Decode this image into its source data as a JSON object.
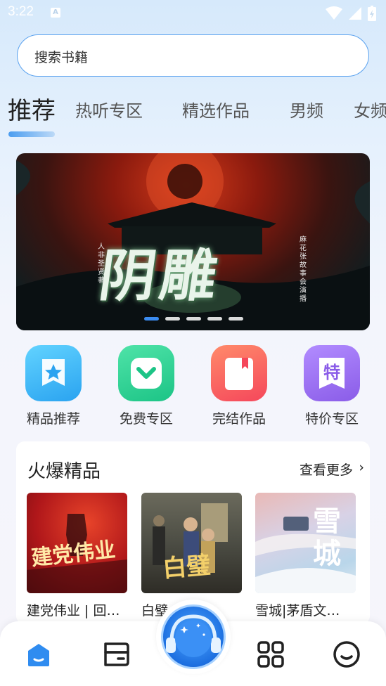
{
  "status_bar": {
    "time": "3:22",
    "notification_letter": "A"
  },
  "search": {
    "placeholder": "搜索书籍"
  },
  "tabs": [
    {
      "label": "推荐",
      "active": true
    },
    {
      "label": "热听专区"
    },
    {
      "label": "精选作品"
    },
    {
      "label": "男频"
    },
    {
      "label": "女频"
    }
  ],
  "banner": {
    "title": "阴雕",
    "side_left": "人非圣贤著",
    "side_right": "麻花张故事会演播",
    "dots": 5,
    "active_dot": 0
  },
  "categories": [
    {
      "label": "精品推荐",
      "icon": "star-badge-icon",
      "color": "#34b6f5"
    },
    {
      "label": "免费专区",
      "icon": "chevron-down-box-icon",
      "color": "#25cf8f"
    },
    {
      "label": "完结作品",
      "icon": "bookmark-book-icon",
      "color": "#f8605b"
    },
    {
      "label": "特价专区",
      "icon": "special-price-icon",
      "color": "#9b6ff0"
    }
  ],
  "hot": {
    "title": "火爆精品",
    "more": "查看更多",
    "books": [
      {
        "title": "建党伟业 | 回…",
        "cover_text": "建党伟业"
      },
      {
        "title": "白璧 | 同名…",
        "cover_text": "白璧"
      },
      {
        "title": "雪城|茅盾文…",
        "cover_text": "雪城"
      }
    ]
  },
  "bottom_nav": [
    {
      "icon": "home-icon",
      "active": true
    },
    {
      "icon": "bookshelf-icon"
    },
    {
      "icon": "listen-headphones-icon"
    },
    {
      "icon": "category-grid-icon"
    },
    {
      "icon": "profile-smile-icon"
    }
  ]
}
